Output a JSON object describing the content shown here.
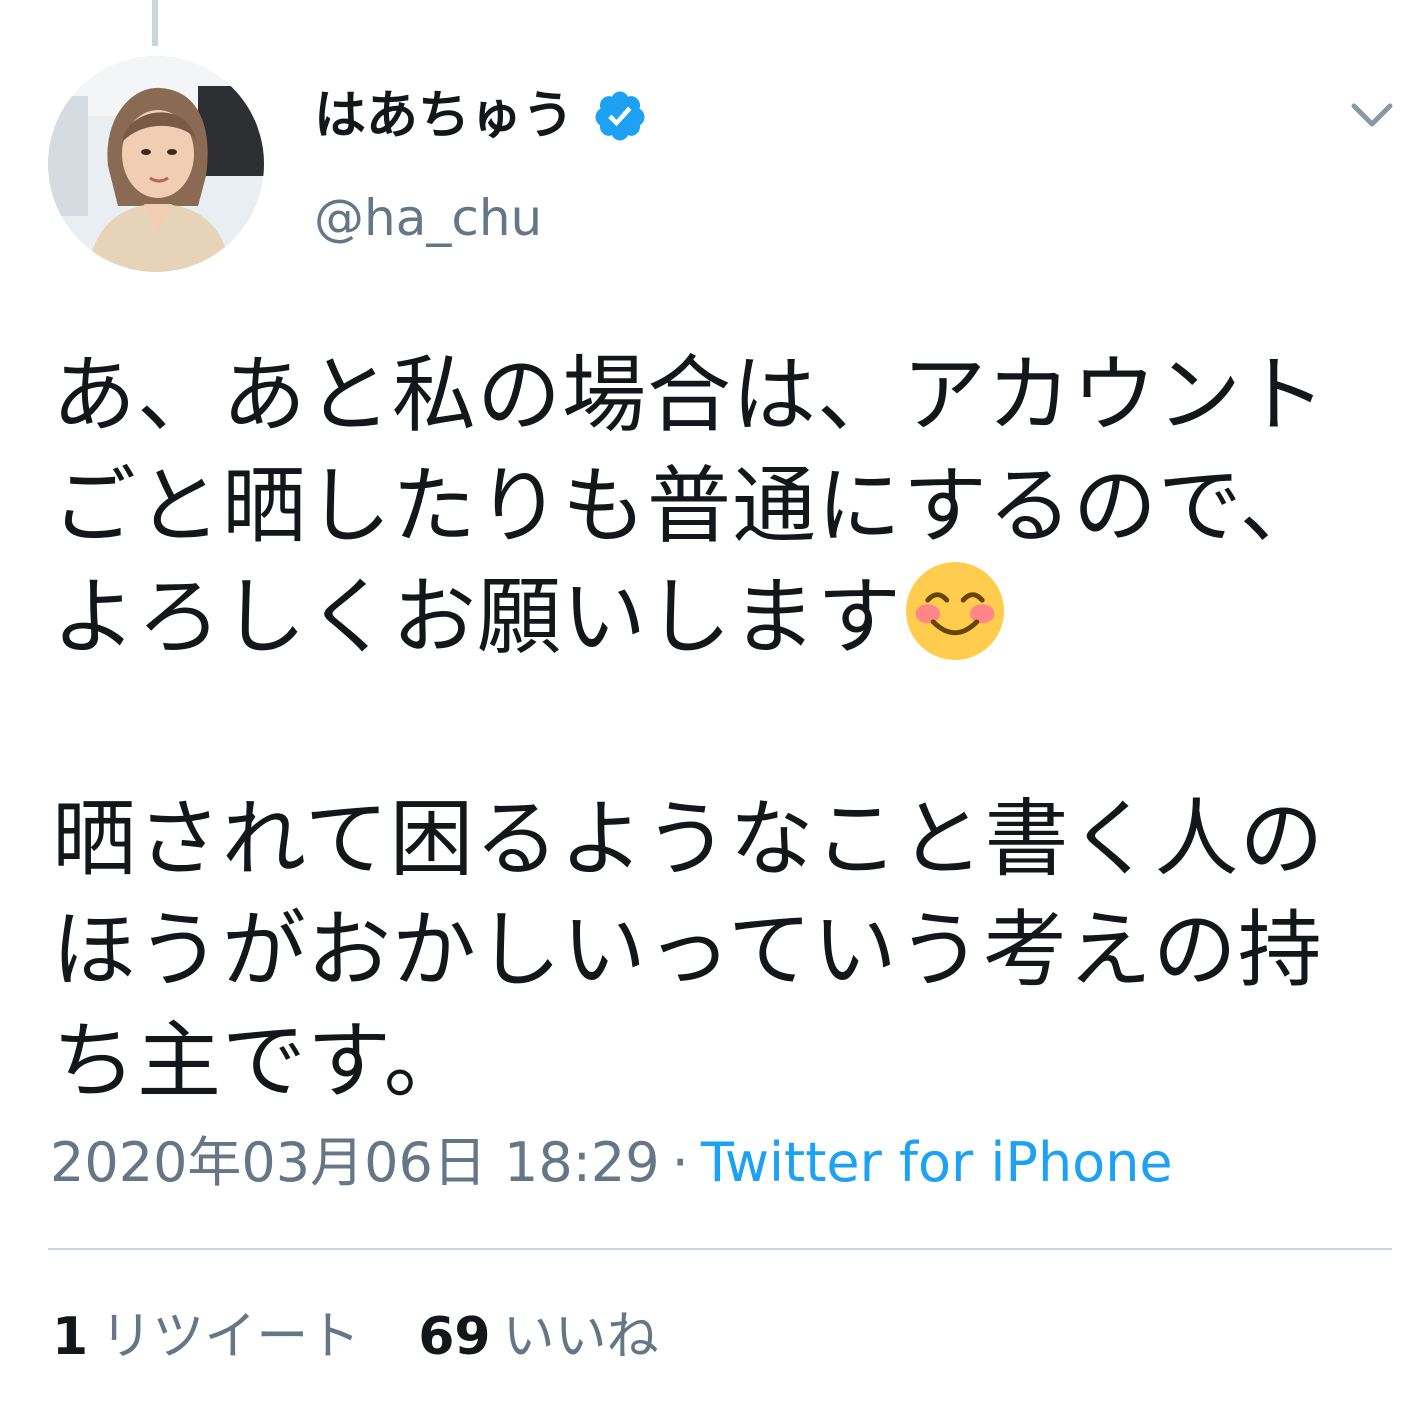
{
  "tweet": {
    "display_name": "はあちゅう",
    "handle": "@ha_chu",
    "verified_icon": "verified-badge-icon",
    "menu_icon": "chevron-down-icon",
    "avatar_icon": "profile-photo",
    "text_part1": "あ、あと私の場合は、アカウントごと晒したりも普通にするので、よろしくお願いします",
    "emoji_icon": "smiling-face-with-smiling-eyes-icon",
    "text_part2": "\n\n晒されて困るようなこと書く人のほうがおかしいっていう考えの持ち主です。",
    "timestamp": "2020年03月06日 18:29",
    "separator": "·",
    "source": "Twitter for iPhone",
    "retweet_count": "1",
    "retweet_label": "リツイート",
    "like_count": "69",
    "like_label": "いいね",
    "accent_color": "#1da1f2",
    "secondary_text_color": "#657786"
  }
}
